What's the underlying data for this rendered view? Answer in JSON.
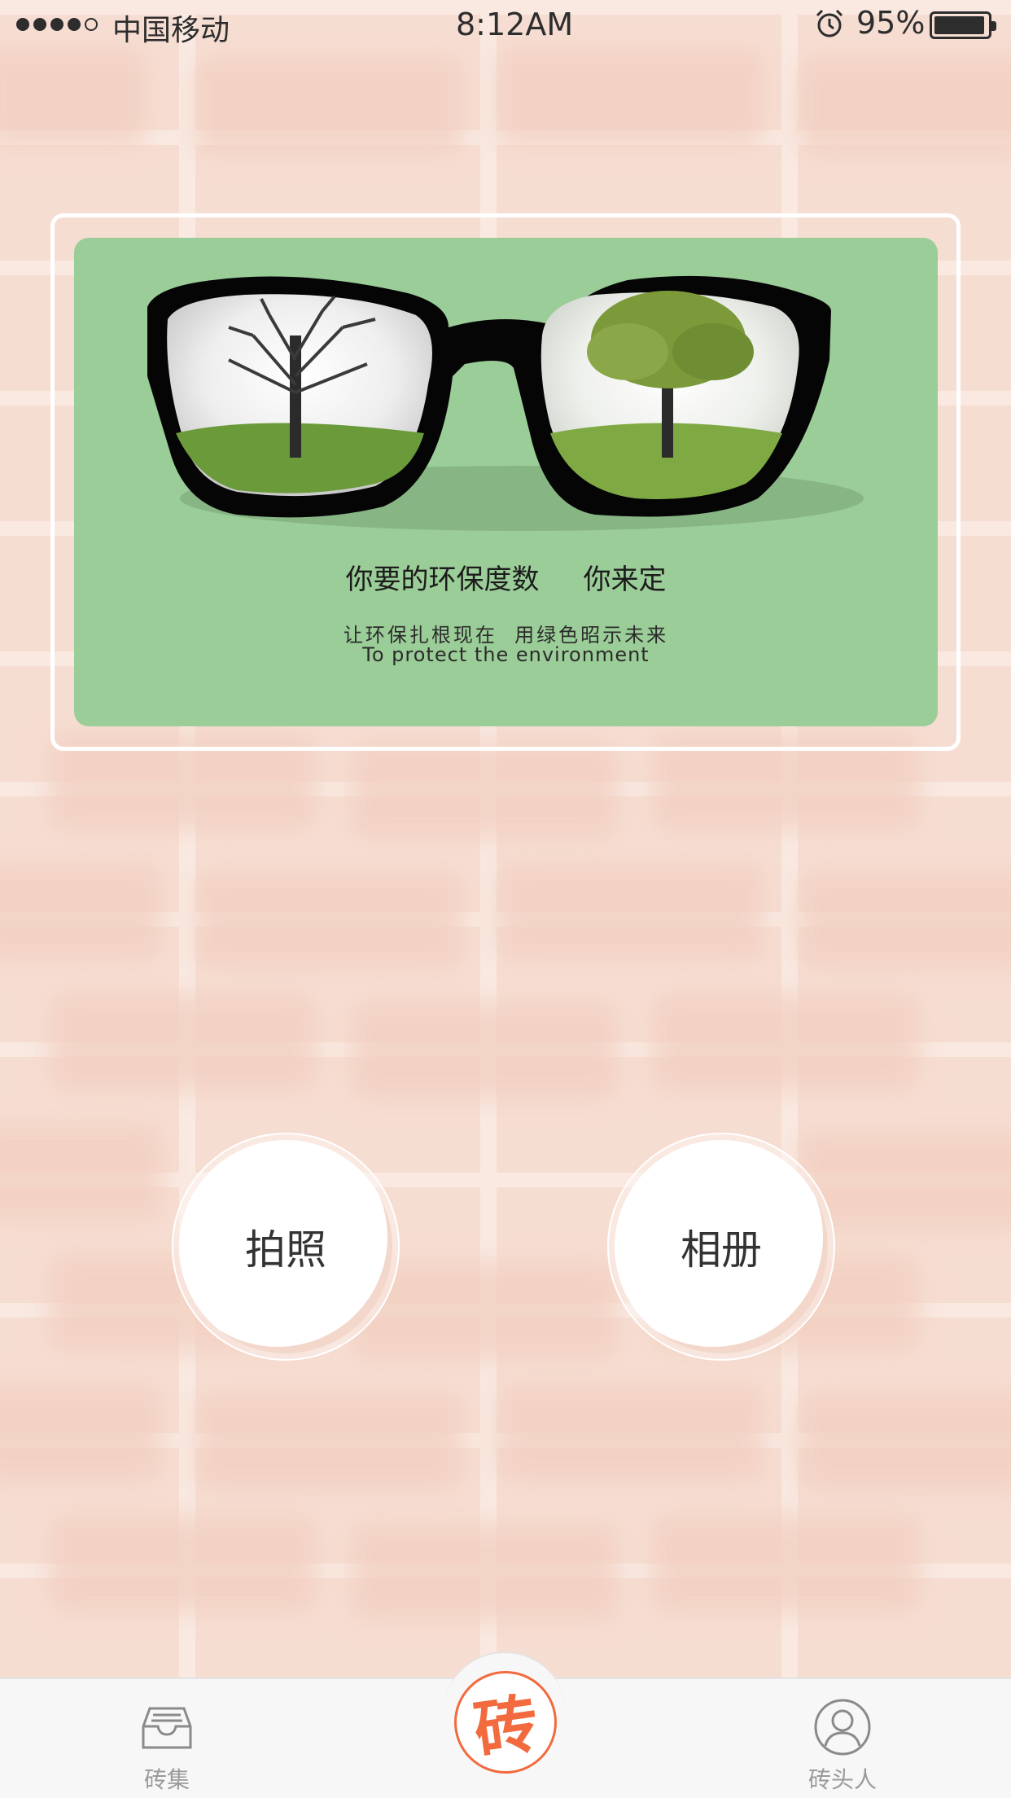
{
  "status_bar": {
    "carrier": "中国移动",
    "time": "8:12AM",
    "battery_percent": "95%",
    "battery_level": 0.95,
    "signal_bars_filled": 4,
    "signal_bars_total": 5,
    "alarm_icon": "alarm-clock-icon"
  },
  "banner": {
    "headline": "你要的环保度数     你来定",
    "subline_cn": "让环保扎根现在  用绿色昭示未来",
    "subline_en": "To protect the environment",
    "background_color": "#9bcd98"
  },
  "actions": {
    "photo_label": "拍照",
    "album_label": "相册"
  },
  "tab_bar": {
    "left_label": "砖集",
    "left_icon": "inbox-tray-icon",
    "center_glyph": "砖",
    "center_color": "#f26a3d",
    "right_label": "砖头人",
    "right_icon": "user-profile-icon"
  }
}
